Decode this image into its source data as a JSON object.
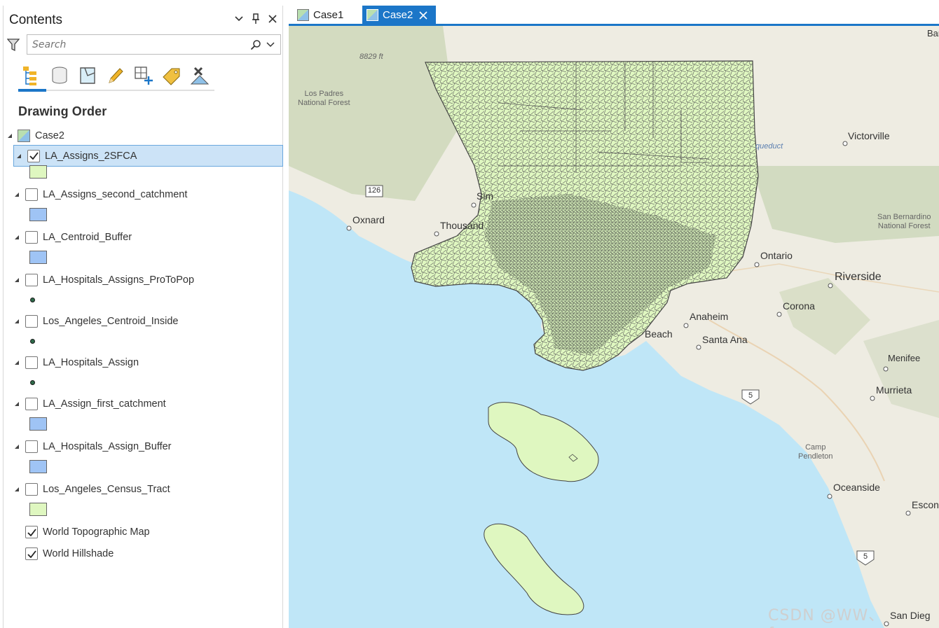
{
  "contents_pane": {
    "title": "Contents",
    "search_placeholder": "Search",
    "section_title": "Drawing Order",
    "map_name": "Case2",
    "layers": [
      {
        "label": "LA_Assigns_2SFCA",
        "checked": true,
        "symbol": "fill",
        "color": "#dff7c0"
      },
      {
        "label": "LA_Assigns_second_catchment",
        "checked": false,
        "symbol": "fill",
        "color": "#9fc4f5"
      },
      {
        "label": "LA_Centroid_Buffer",
        "checked": false,
        "symbol": "fill",
        "color": "#9fc4f5"
      },
      {
        "label": "LA_Hospitals_Assigns_ProToPop",
        "checked": false,
        "symbol": "point",
        "color": "#2e6b4a"
      },
      {
        "label": "Los_Angeles_Centroid_Inside",
        "checked": false,
        "symbol": "point",
        "color": "#2e6b4a"
      },
      {
        "label": "LA_Hospitals_Assign",
        "checked": false,
        "symbol": "point",
        "color": "#2e6b4a"
      },
      {
        "label": "LA_Assign_first_catchment",
        "checked": false,
        "symbol": "fill",
        "color": "#9fc4f5"
      },
      {
        "label": "LA_Hospitals_Assign_Buffer",
        "checked": false,
        "symbol": "fill",
        "color": "#9fc4f5"
      },
      {
        "label": "Los_Angeles_Census_Tract",
        "checked": false,
        "symbol": "fill",
        "color": "#dff7c0"
      }
    ],
    "basemaps": [
      {
        "label": "World Topographic Map",
        "checked": true
      },
      {
        "label": "World Hillshade",
        "checked": true
      }
    ]
  },
  "tabs": [
    {
      "label": "Case1",
      "active": false
    },
    {
      "label": "Case2",
      "active": true
    }
  ],
  "map": {
    "places": [
      "Victorville",
      "Oxnard",
      "Thousand",
      "Sim",
      "Ontario",
      "Riverside",
      "Corona",
      "Anaheim",
      "Beach",
      "Santa Ana",
      "Menifee",
      "Murrieta",
      "Oceanside",
      "Escon",
      "San Dieg",
      "Bar"
    ],
    "regions": [
      "Los Padres\nNational Forest",
      "San Bernardino\nNational Forest",
      "Camp\nPendleton"
    ],
    "elevation": "8829 ft",
    "aqueduct": "queduct",
    "route_126": "126",
    "route_5a": "5",
    "route_5b": "5",
    "watermark": "CSDN @WW、forever"
  },
  "colors": {
    "accent": "#1b76c8",
    "polygon_fill": "#dff7c0",
    "ocean": "#bfe6f7"
  }
}
